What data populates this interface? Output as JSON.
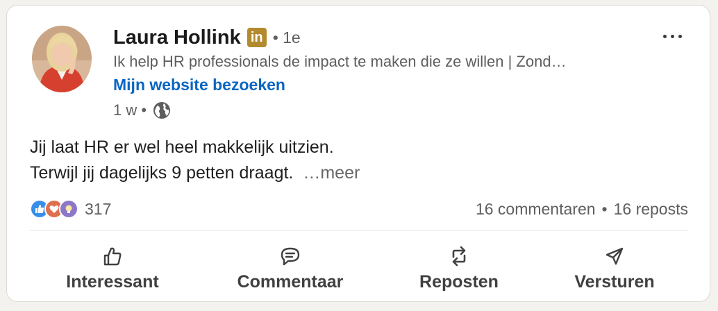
{
  "post": {
    "author": {
      "name": "Laura Hollink",
      "badge": "in",
      "degree": "• 1e",
      "headline": "Ik help HR professionals de impact te maken die ze willen | Zond…",
      "website_link": "Mijn website bezoeken",
      "time": "1 w •"
    },
    "text": {
      "line1": "Jij laat HR er wel heel makkelijk uitzien.",
      "line2": "Terwijl jij dagelijks 9 petten draagt.",
      "see_more": "…meer"
    },
    "reactions": {
      "count": "317",
      "types": [
        "like-icon",
        "love-icon",
        "insightful-icon"
      ]
    },
    "comments": "16 commentaren",
    "separator": "•",
    "reposts": "16 reposts"
  },
  "actions": [
    {
      "label": "Interessant",
      "icon": "thumbs-up-icon"
    },
    {
      "label": "Commentaar",
      "icon": "comment-icon"
    },
    {
      "label": "Reposten",
      "icon": "repost-icon"
    },
    {
      "label": "Versturen",
      "icon": "send-icon"
    }
  ],
  "colors": {
    "accent": "#0a66c2",
    "badge": "#b48a2e",
    "like": "#378fe9",
    "love": "#df704d",
    "insightful": "#8c78c8"
  }
}
